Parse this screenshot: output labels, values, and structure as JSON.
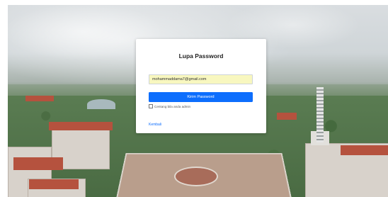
{
  "form": {
    "title": "Lupa Password",
    "email_value": "mohammaddama7@gmail.com",
    "submit_label": "Kirim Password",
    "remember_label": "Centang bila anda admin",
    "back_label": "Kembali"
  },
  "colors": {
    "primary": "#0d6efd",
    "input_autofill_bg": "#f8f7bf",
    "card_bg": "#ffffff"
  }
}
